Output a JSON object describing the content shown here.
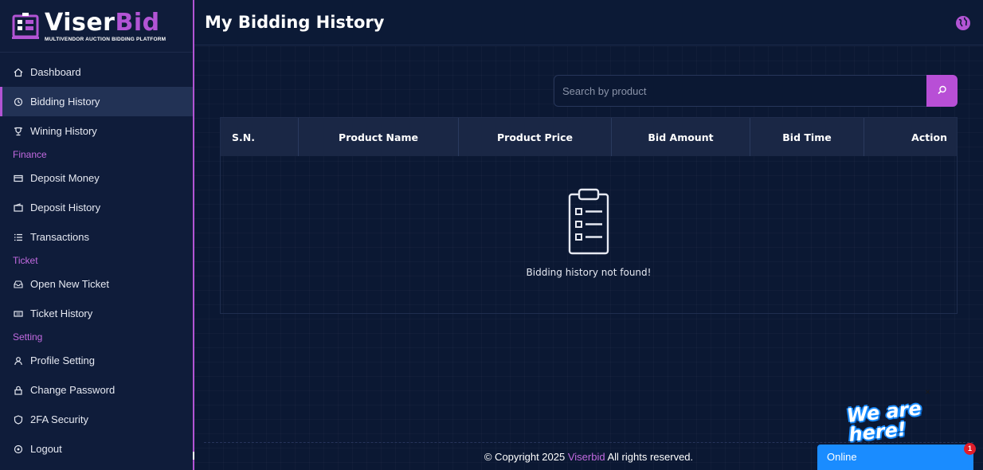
{
  "brand": {
    "name_part1": "Viser",
    "name_part2": "Bid",
    "tagline": "MULTIVENDOR AUCTION BIDDING PLATFORM"
  },
  "sidebar": {
    "items": [
      {
        "label": "Dashboard",
        "icon": "home-icon"
      },
      {
        "label": "Bidding History",
        "icon": "history-icon",
        "active": true
      },
      {
        "label": "Wining History",
        "icon": "trophy-icon"
      }
    ],
    "finance_label": "Finance",
    "finance_items": [
      {
        "label": "Deposit Money",
        "icon": "credit-card-icon"
      },
      {
        "label": "Deposit History",
        "icon": "wallet-icon"
      },
      {
        "label": "Transactions",
        "icon": "list-icon"
      }
    ],
    "ticket_label": "Ticket",
    "ticket_items": [
      {
        "label": "Open New Ticket",
        "icon": "inbox-icon"
      },
      {
        "label": "Ticket History",
        "icon": "ticket-icon"
      }
    ],
    "setting_label": "Setting",
    "setting_items": [
      {
        "label": "Profile Setting",
        "icon": "user-icon"
      },
      {
        "label": "Change Password",
        "icon": "lock-icon"
      },
      {
        "label": "2FA Security",
        "icon": "shield-icon"
      },
      {
        "label": "Logout",
        "icon": "logout-icon"
      }
    ]
  },
  "header": {
    "title": "My Bidding History",
    "language_icon": "globe-icon"
  },
  "search": {
    "placeholder": "Search by product",
    "value": ""
  },
  "table": {
    "columns": [
      "S.N.",
      "Product Name",
      "Product Price",
      "Bid Amount",
      "Bid Time",
      "Action"
    ],
    "rows": [],
    "empty_message": "Bidding history not found!"
  },
  "footer": {
    "prefix": "© Copyright 2025",
    "brand": "Viserbid",
    "suffix": "All rights reserved."
  },
  "chat": {
    "banner_text": "We are here!",
    "close_label": "×",
    "status": "Online",
    "badge_count": "1"
  },
  "colors": {
    "accent": "#b254d4",
    "background": "#0c1a36",
    "chat_blue": "#1a8cff"
  }
}
